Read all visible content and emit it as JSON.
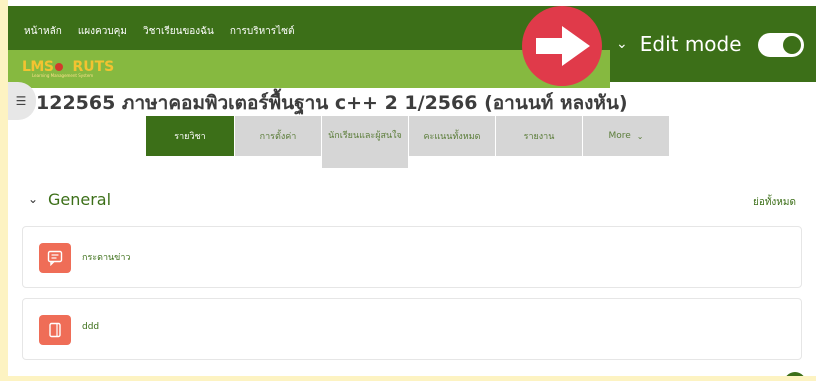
{
  "nav": {
    "items": [
      "หน้าหลัก",
      "แผงควบคุม",
      "วิชาเรียนของฉัน",
      "การบริหารไซต์"
    ]
  },
  "logo": {
    "text_lms": "LMS",
    "text_ruts": "RUTS",
    "subtitle": "Learning Management System"
  },
  "edit_mode": {
    "label": "Edit mode",
    "enabled": true
  },
  "course": {
    "title": "122565 ภาษาคอมพิวเตอร์พื้นฐาน c++ 2 1/2566 (อานนท์ หลงหัน)"
  },
  "tabs": [
    {
      "label": "รายวิชา",
      "active": true
    },
    {
      "label": "การตั้งค่า",
      "active": false
    },
    {
      "label": "นักเรียนและผู้สนใจ",
      "active": false
    },
    {
      "label": "คะแนนทั้งหมด",
      "active": false
    },
    {
      "label": "รายงาน",
      "active": false
    },
    {
      "label": "More",
      "active": false
    }
  ],
  "section": {
    "title": "General",
    "collapse_label": "ย่อทั้งหมด"
  },
  "activities": [
    {
      "name": "กระดานข่าว",
      "icon": "forum-icon"
    },
    {
      "name": "ddd",
      "icon": "page-icon"
    }
  ],
  "colors": {
    "primary": "#3c6f18",
    "accent": "#86b940",
    "highlight": "#e03a4a",
    "activity_icon": "#ef6d57",
    "backdrop": "#fdf3c2"
  }
}
